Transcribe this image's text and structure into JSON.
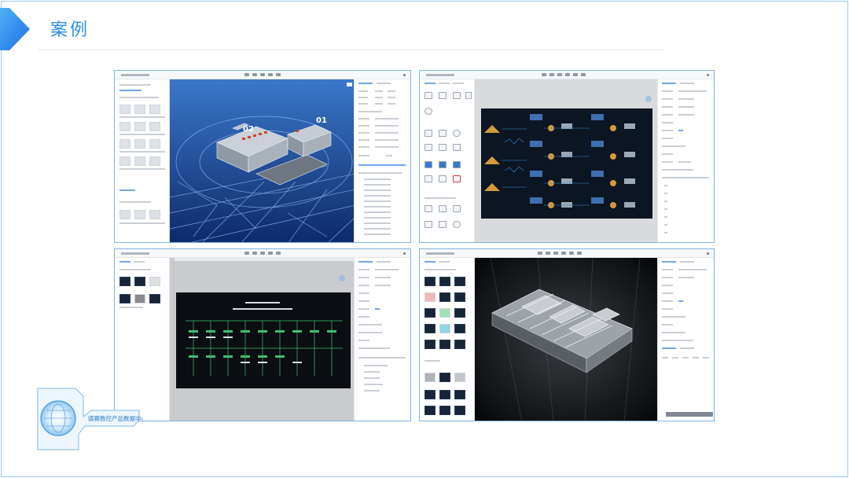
{
  "slide": {
    "title": "案例",
    "accent_color": "#2a8ee6",
    "border_color": "#9ec8ee"
  },
  "screenshots": [
    {
      "name": "editor-3d-campus",
      "theme": "3d-wireframe-campus",
      "labels": [
        "02",
        "01"
      ]
    },
    {
      "name": "editor-topology-dashboard",
      "theme": "dark-dashboard"
    },
    {
      "name": "editor-wiring-diagram",
      "theme": "dark-wiring-diagram"
    },
    {
      "name": "editor-3d-floor-model",
      "theme": "3d-floor-model"
    }
  ],
  "badge": {
    "text": "德赛数控产品数据中心",
    "icon": "globe-emblem-icon"
  }
}
